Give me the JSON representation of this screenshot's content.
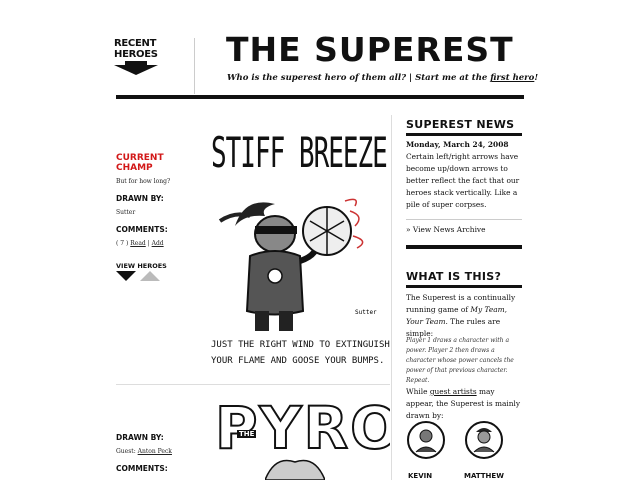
{
  "header": {
    "recent_heroes_line1": "RECENT",
    "recent_heroes_line2": "HEROES",
    "title": "THE SUPEREST",
    "tagline_prefix": "Who is the superest hero of them all?  |  Start me at the ",
    "tagline_link": "first hero",
    "tagline_suffix": "!"
  },
  "left": {
    "current_line1": "CURRENT",
    "current_line2": "CHAMP",
    "current_sub": "But for how long?",
    "drawn_by_label": "DRAWN BY:",
    "drawn_by_value": "Sutter",
    "comments_label": "COMMENTS:",
    "comments_count": "( 7 )",
    "read_link": "Read",
    "sep": "|",
    "add_link": "Add",
    "view_heroes": "VIEW HEROES",
    "drawn_by_label2": "DRAWN BY:",
    "guest_prefix": "Guest: ",
    "guest_name": "Anton Peck",
    "comments_label2": "COMMENTS:"
  },
  "art": {
    "hero1_title": "STIFF BREEZE",
    "hero1_caption_line1": "JUST THE RIGHT WIND TO EXTINGUISH",
    "hero1_caption_line2": "YOUR FLAME AND GOOSE YOUR BUMPS.",
    "hero1_signature": "Sutter",
    "hero2_title_the": "THE",
    "hero2_title": "PYRO"
  },
  "sidebar": {
    "news_heading": "SUPEREST NEWS",
    "news_date": "Monday, March 24, 2008",
    "news_body": "Certain left/right arrows have become up/down arrows to better reflect the fact that our heroes stack vertically. Like a pile of super corpses.",
    "news_archive": "» View News Archive",
    "what_heading": "WHAT IS THIS?",
    "what_body_prefix": "The Superest is a continually running game of ",
    "what_body_em": "My Team, Your Team.",
    "what_body_suffix": " The rules are simple:",
    "rules": "Player 1 draws a character with a power. Player 2 then draws a character whose power cancels the power of that previous character. Repeat.",
    "guest_prefix": "While ",
    "guest_link": "guest artists",
    "guest_suffix": " may appear, the Superest is mainly drawn by:",
    "artist1": "KEVIN",
    "artist2": "MATTHEW"
  }
}
